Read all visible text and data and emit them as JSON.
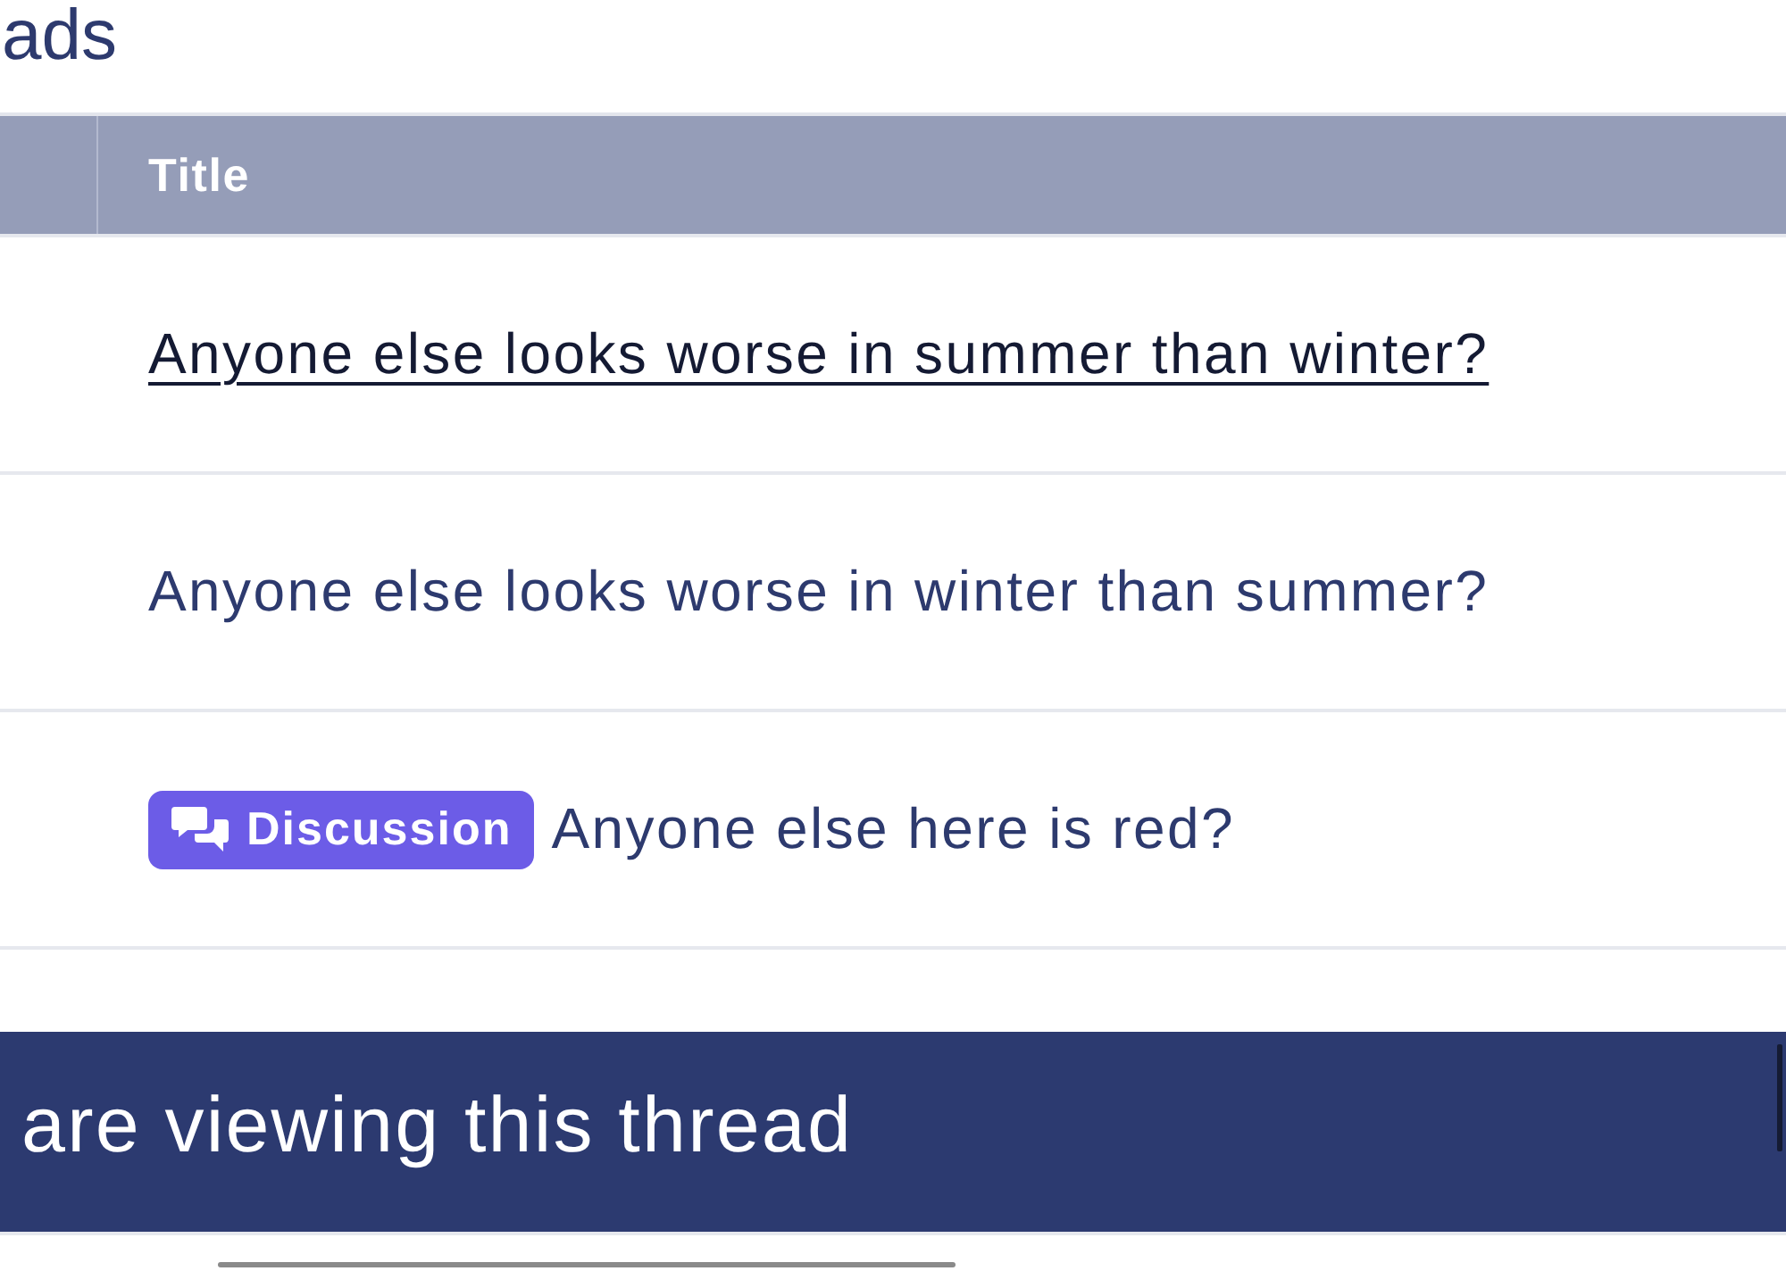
{
  "heading": {
    "title": "ads"
  },
  "table": {
    "columns": [
      {
        "label": "Title"
      }
    ],
    "rows": [
      {
        "title": "Anyone else looks worse in summer than winter?",
        "hovered": true
      },
      {
        "title": "Anyone else looks worse in winter than summer?",
        "hovered": false
      },
      {
        "title": "Anyone else here is red?",
        "hovered": false,
        "prefix": {
          "label": "Discussion",
          "color": "#6c5ce7"
        }
      }
    ]
  },
  "viewers_bar": {
    "text": "are viewing this thread"
  }
}
